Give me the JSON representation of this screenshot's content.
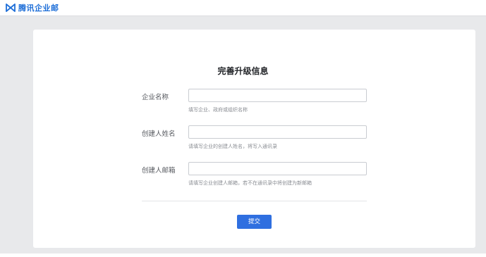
{
  "header": {
    "brand": "腾讯企业邮",
    "logo_icon": "tencent-logo-icon",
    "brand_color": "#1f6fd8"
  },
  "form": {
    "title": "完善升级信息",
    "fields": [
      {
        "label": "企业名称",
        "value": "",
        "placeholder": "",
        "hint": "填写企业、政府或组织名称"
      },
      {
        "label": "创建人姓名",
        "value": "",
        "placeholder": "",
        "hint": "请填写企业的创建人姓名，将写入通讯录"
      },
      {
        "label": "创建人邮箱",
        "value": "",
        "placeholder": "",
        "hint": "请填写企业创建人邮箱，若不在通讯录中将创建为新邮箱"
      }
    ],
    "submit_label": "提交",
    "accent_color": "#2f6fe0"
  }
}
